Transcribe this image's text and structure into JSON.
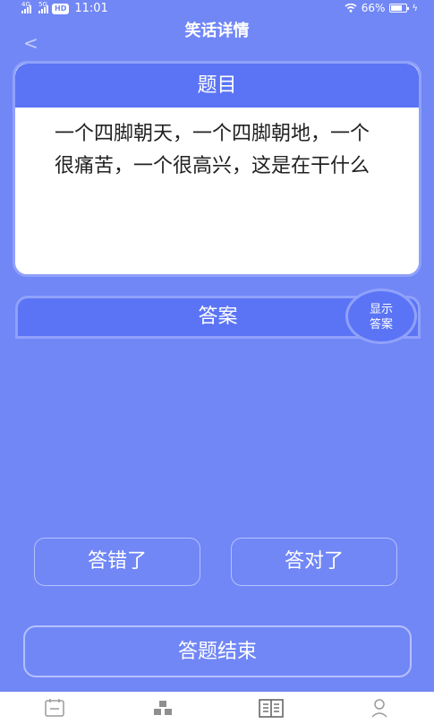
{
  "status_bar": {
    "network1": "4G",
    "network2": "5G",
    "hd": "HD",
    "time": "11:01",
    "battery": "66%"
  },
  "nav": {
    "title": "笑话详情",
    "back": "<"
  },
  "question": {
    "header": "题目",
    "text": "一个四脚朝天，一个四脚朝地，一个很痛苦，一个很高兴，这是在干什么"
  },
  "answer": {
    "header": "答案",
    "show_button": "显示\n答案"
  },
  "buttons": {
    "wrong": "答错了",
    "correct": "答对了",
    "finish": "答题结束"
  },
  "tabs": [
    {
      "icon": "calendar-icon"
    },
    {
      "icon": "pyramid-icon"
    },
    {
      "icon": "book-icon"
    },
    {
      "icon": "user-icon"
    }
  ]
}
